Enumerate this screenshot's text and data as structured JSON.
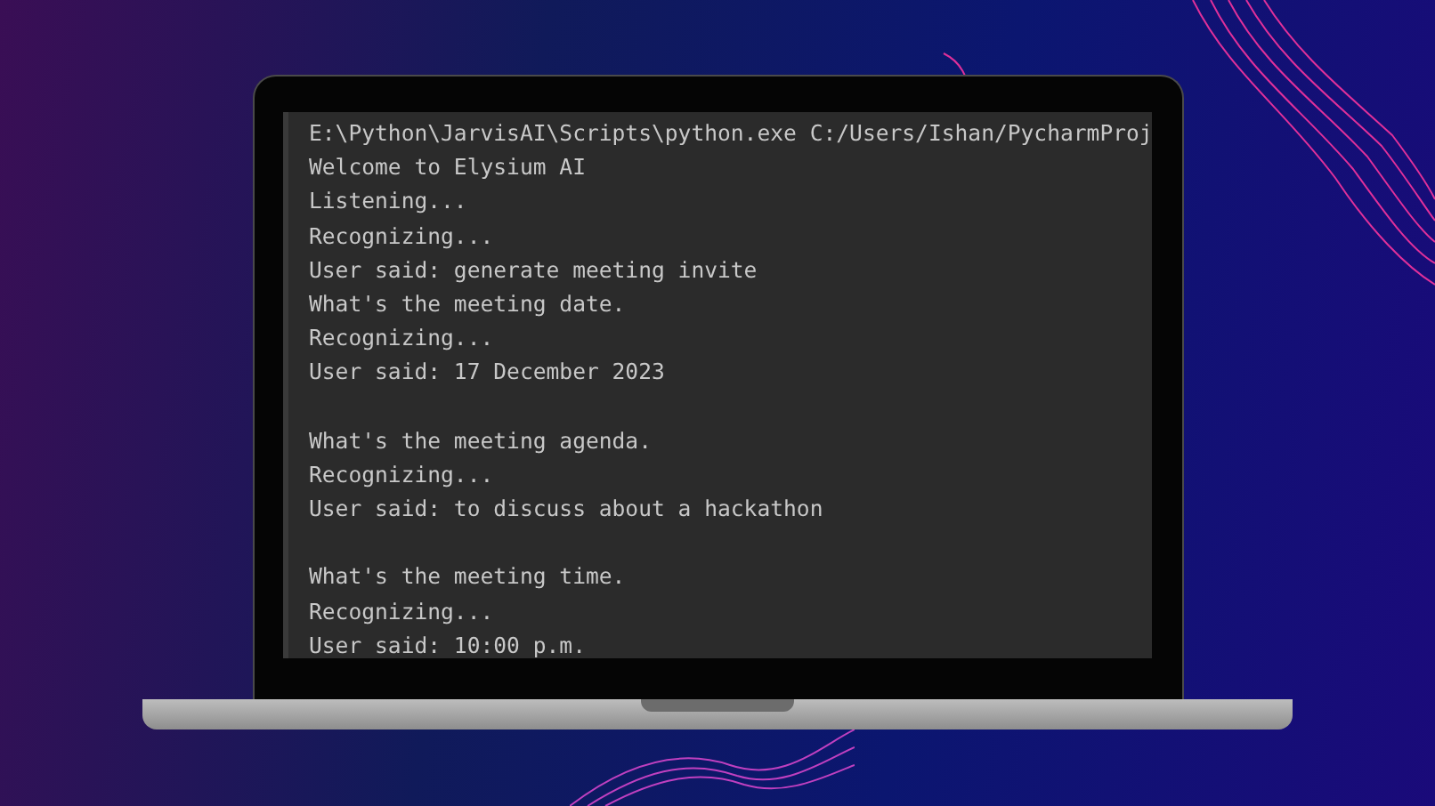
{
  "console": {
    "blocks": [
      [
        "E:\\Python\\JarvisAI\\Scripts\\python.exe C:/Users/Ishan/PycharmProj",
        "Welcome to Elysium AI",
        "Listening...",
        "Recognizing...",
        "User said: generate meeting invite",
        "What's the meeting date.",
        "Recognizing...",
        "User said: 17 December 2023"
      ],
      [
        "What's the meeting agenda.",
        "Recognizing...",
        "User said: to discuss about a hackathon"
      ],
      [
        "What's the meeting time.",
        "Recognizing...",
        "User said: 10:00 p.m."
      ]
    ]
  }
}
